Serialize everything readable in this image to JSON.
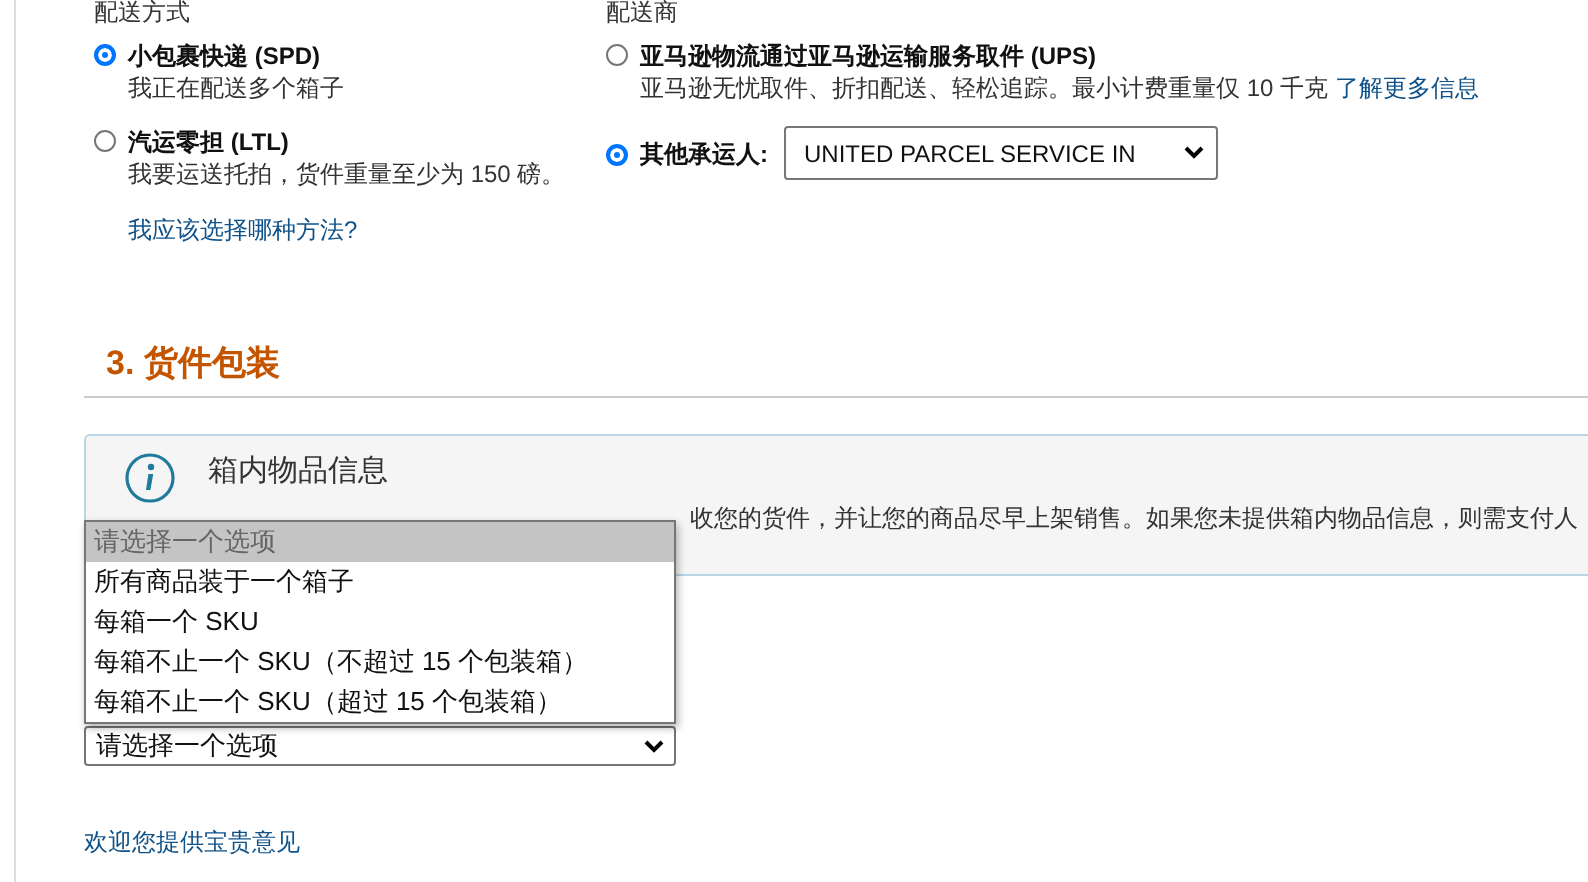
{
  "delivery_method": {
    "heading": "配送方式",
    "options": [
      {
        "title": "小包裹快递 (SPD)",
        "description": "我正在配送多个箱子",
        "selected": true
      },
      {
        "title": "汽运零担 (LTL)",
        "description": "我要运送托拍，货件重量至少为 150 磅。",
        "selected": false
      }
    ],
    "help_link": "我应该选择哪种方法?"
  },
  "carrier": {
    "heading": "配送商",
    "options": [
      {
        "kind": "partnered",
        "title": "亚马逊物流通过亚马逊运输服务取件 (UPS)",
        "description": "亚马逊无忧取件、折扣配送、轻松追踪。最小计费重量仅 10 千克",
        "link": "了解更多信息",
        "selected": false
      },
      {
        "kind": "other",
        "label": "其他承运人:",
        "value": "UNITED PARCEL SERVICE IN",
        "selected": true
      }
    ]
  },
  "section": {
    "title": "3. 货件包装",
    "info": {
      "title": "箱内物品信息",
      "body": "收您的货件，并让您的商品尽早上架销售。如果您未提供箱内物品信息，则需支付人"
    },
    "packing_select": {
      "value": "请选择一个选项",
      "open": true,
      "options": [
        {
          "label": "请选择一个选项",
          "selected": true
        },
        {
          "label": "所有商品装于一个箱子",
          "selected": false
        },
        {
          "label": "每箱一个 SKU",
          "selected": false
        },
        {
          "label": "每箱不止一个 SKU（不超过 15 个包装箱）",
          "selected": false
        },
        {
          "label": "每箱不止一个 SKU（超过 15 个包装箱）",
          "selected": false
        }
      ]
    }
  },
  "feedback_link": "欢迎您提供宝贵意见"
}
